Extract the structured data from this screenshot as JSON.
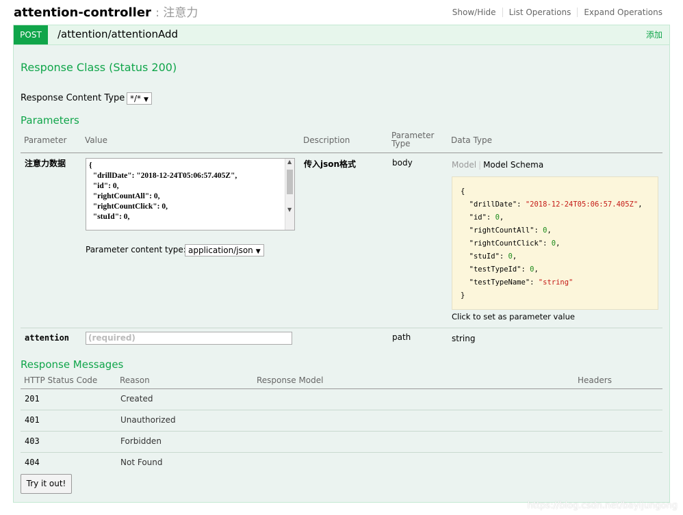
{
  "resource": {
    "name": "attention-controller",
    "description": ": 注意力",
    "operations": [
      "Show/Hide",
      "List Operations",
      "Expand Operations"
    ]
  },
  "operation": {
    "method": "POST",
    "path": "/attention/attentionAdd",
    "summary": "添加"
  },
  "response_class": {
    "title": "Response Class (Status 200)"
  },
  "response_content_type": {
    "label": "Response Content Type",
    "value": "*/*"
  },
  "parameters": {
    "title": "Parameters",
    "headers": [
      "Parameter",
      "Value",
      "Description",
      "Parameter Type",
      "Data Type"
    ],
    "rows": [
      {
        "name": "注意力数据",
        "value_text": "{\n  \"drillDate\": \"2018-12-24T05:06:57.405Z\",\n  \"id\": 0,\n  \"rightCountAll\": 0,\n  \"rightCountClick\": 0,\n  \"stuId\": 0,",
        "content_type_label": "Parameter content type:",
        "content_type_value": "application/json",
        "description": "传入json格式",
        "param_type": "body",
        "model_tab": "Model",
        "model_schema_tab": "Model Schema",
        "click_to_set": "Click to set as parameter value"
      },
      {
        "name": "attention",
        "placeholder": "(required)",
        "param_type": "path",
        "data_type": "string"
      }
    ]
  },
  "schema": {
    "fields": [
      {
        "key": "\"drillDate\"",
        "value": "\"2018-12-24T05:06:57.405Z\"",
        "kind": "string"
      },
      {
        "key": "\"id\"",
        "value": "0",
        "kind": "number"
      },
      {
        "key": "\"rightCountAll\"",
        "value": "0",
        "kind": "number"
      },
      {
        "key": "\"rightCountClick\"",
        "value": "0",
        "kind": "number"
      },
      {
        "key": "\"stuId\"",
        "value": "0",
        "kind": "number"
      },
      {
        "key": "\"testTypeId\"",
        "value": "0",
        "kind": "number"
      },
      {
        "key": "\"testTypeName\"",
        "value": "\"string\"",
        "kind": "string"
      }
    ]
  },
  "response_messages": {
    "title": "Response Messages",
    "headers": [
      "HTTP Status Code",
      "Reason",
      "Response Model",
      "Headers"
    ],
    "rows": [
      {
        "code": "201",
        "reason": "Created"
      },
      {
        "code": "401",
        "reason": "Unauthorized"
      },
      {
        "code": "403",
        "reason": "Forbidden"
      },
      {
        "code": "404",
        "reason": "Not Found"
      }
    ]
  },
  "try_button": "Try it out!",
  "watermark": "https://blog.csdn.net/bayijungong",
  "colors": {
    "post": "#10a54a",
    "section_title": "#10a54a",
    "panel_bg": "#ebf3f0",
    "schema_bg": "#fcf6db"
  }
}
